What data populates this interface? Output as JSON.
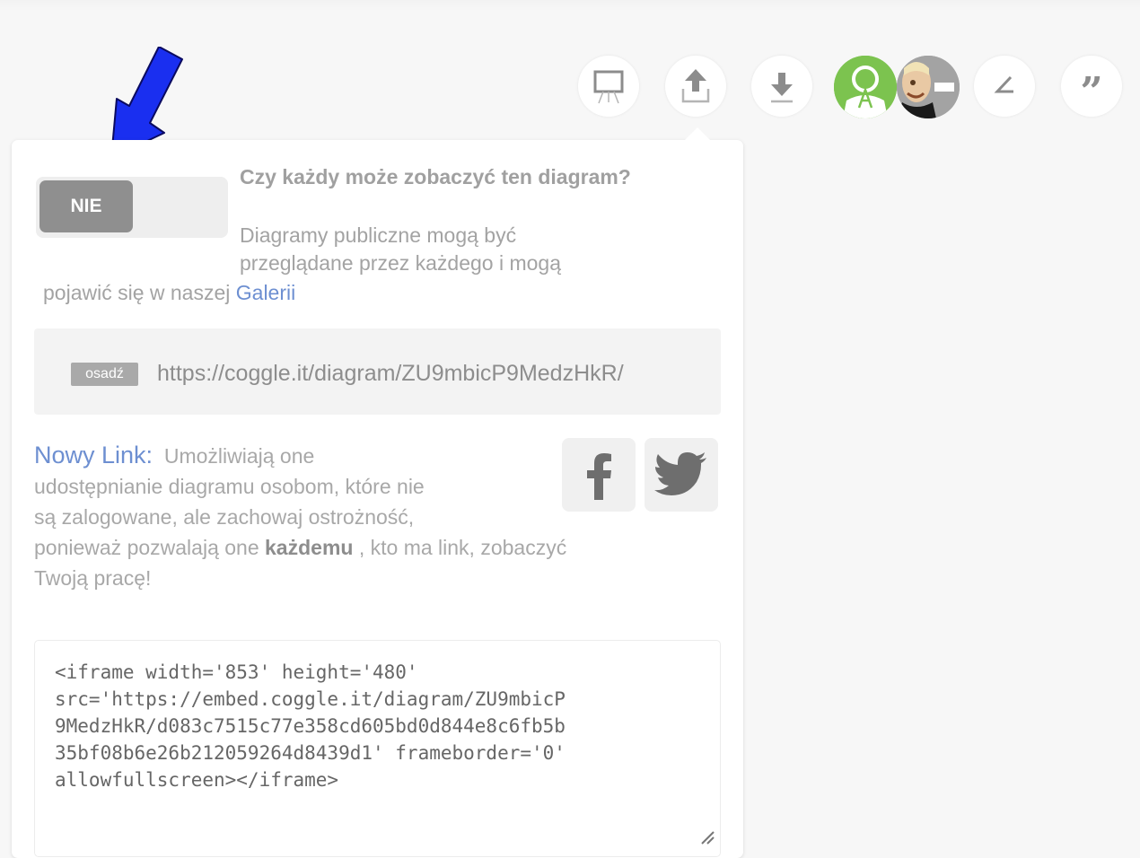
{
  "toolbar": {
    "buttons": [
      {
        "icon": "presentation-icon"
      },
      {
        "icon": "share-upload-icon"
      },
      {
        "icon": "download-icon"
      },
      {
        "icon": "collaborator-avatars"
      },
      {
        "icon": "angle-icon"
      },
      {
        "icon": "quote-icon",
        "glyph": "”"
      }
    ]
  },
  "visibility": {
    "toggle_label": "NIE",
    "heading": "Czy każdy może zobaczyć ten diagram?",
    "description_line1": "Diagramy publiczne mogą być",
    "description_line2": "przeglądane przez każdego i mogą",
    "description_line3": "pojawić się w naszej ",
    "gallery_link": "Galerii"
  },
  "embed": {
    "badge": "osadź",
    "url": "https://coggle.it/diagram/ZU9mbicP9MedzHkR/"
  },
  "new_link": {
    "title": "Nowy Link:",
    "line1": "Umożliwiają one",
    "line2": "udostępnianie diagramu osobom, które nie",
    "line3": "są zalogowane, ale zachowaj ostrożność,",
    "line4_pre": "ponieważ pozwalają one ",
    "line4_bold": "każdemu",
    "line4_post": " , kto ma link, zobaczyć",
    "line5": "Twoją pracę!"
  },
  "social": {
    "facebook_icon": "facebook-icon",
    "twitter_icon": "twitter-icon"
  },
  "iframe_code": "<iframe width='853' height='480'\nsrc='https://embed.coggle.it/diagram/ZU9mbicP\n9MedzHkR/d083c7515c77e358cd605bd0d844e8c6fb5b\n35bf08b6e26b212059264d8439d1' frameborder='0'\nallowfullscreen></iframe>",
  "colors": {
    "accent_blue": "#6d8fd1",
    "annotation_arrow": "#1a2ff0",
    "avatar_green": "#7cc34f"
  }
}
